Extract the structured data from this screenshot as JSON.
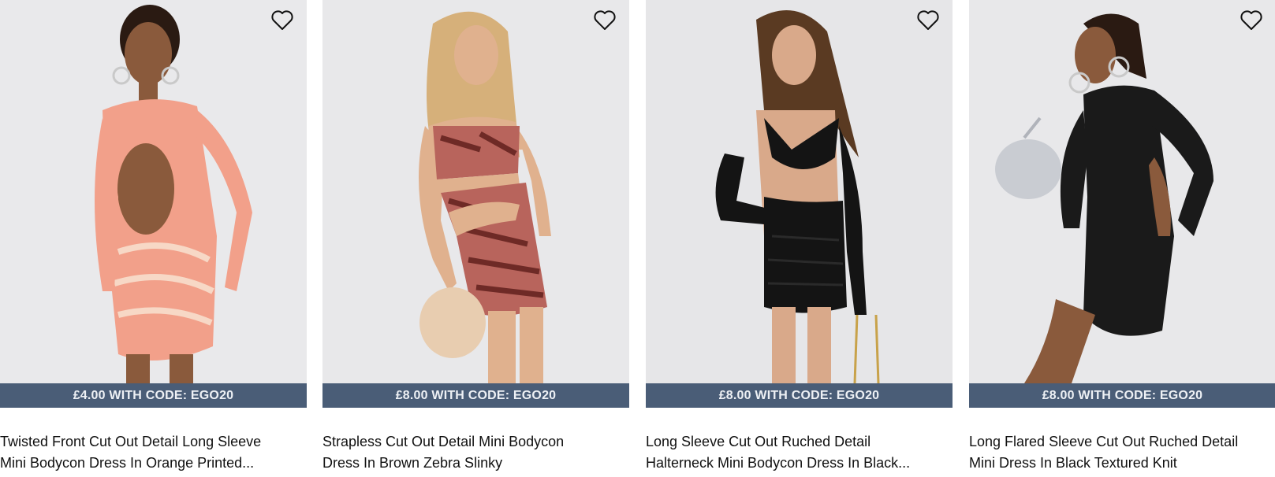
{
  "products": [
    {
      "promo": "£4.00 WITH CODE: EGO20",
      "title_line1": "Twisted Front Cut Out Detail Long Sleeve",
      "title_line2": "Mini Bodycon Dress In Orange Printed...",
      "colors": {
        "dress": "#f2a08a",
        "stripe": "#f7d8c6",
        "skin": "#8a5a3c",
        "hair": "#2a1a12"
      }
    },
    {
      "promo": "£8.00 WITH CODE: EGO20",
      "title_line1": "Strapless Cut Out Detail Mini Bodycon",
      "title_line2": "Dress In Brown Zebra Slinky",
      "colors": {
        "dress": "#b8645c",
        "stripe": "#6e2a26",
        "skin": "#e0b18e",
        "hair": "#d6b07a",
        "bag": "#e8cdb0"
      }
    },
    {
      "promo": "£8.00 WITH CODE: EGO20",
      "title_line1": "Long Sleeve Cut Out Ruched Detail",
      "title_line2": "Halterneck Mini Bodycon Dress In Black...",
      "colors": {
        "dress": "#141414",
        "skin": "#d9a98a",
        "hair": "#5a3a22"
      }
    },
    {
      "promo": "£8.00 WITH CODE: EGO20",
      "title_line1": "Long Flared Sleeve Cut Out Ruched Detail",
      "title_line2": "Mini Dress In Black Textured Knit",
      "colors": {
        "dress": "#1a1a1a",
        "skin": "#8a5a3c",
        "hair": "#2a1a12",
        "bag": "#c9ccd2"
      }
    }
  ],
  "icons": {
    "wishlist": "heart-outline-icon"
  },
  "theme": {
    "promo_bg": "#4a5d77",
    "image_bg": "#e7e7e9"
  }
}
